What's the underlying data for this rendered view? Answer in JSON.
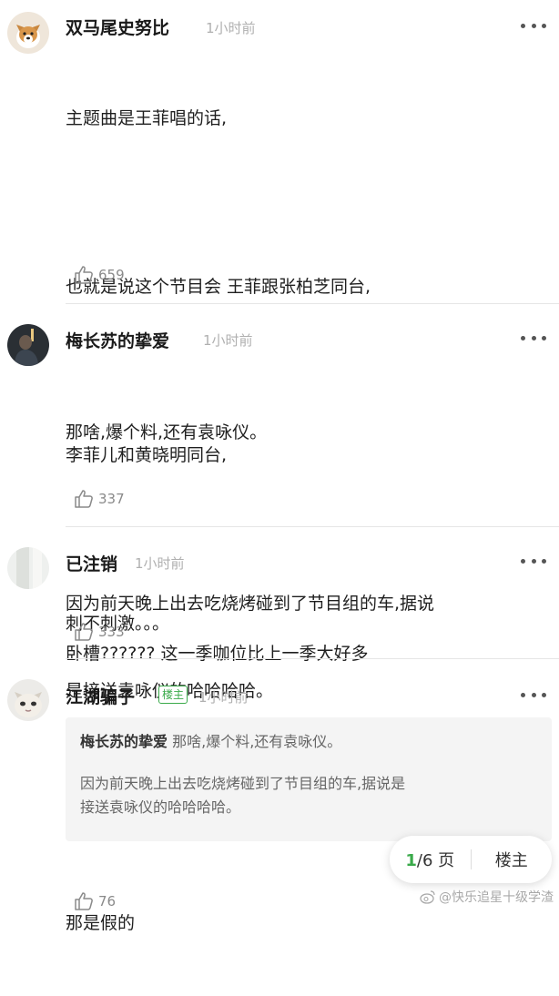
{
  "comments": [
    {
      "username": "双马尾史努比",
      "time": "1小时前",
      "lines": [
        "主题曲是王菲唱的话,",
        "",
        "也就是说这个节目会 王菲跟张柏芝同台,",
        "",
        "李菲儿和黄晓明同台,",
        "",
        "刺不刺激。。。"
      ],
      "likes": "659"
    },
    {
      "username": "梅长苏的挚爱",
      "time": "1小时前",
      "lines": [
        "那啥,爆个料,还有袁咏仪。",
        "",
        "因为前天晚上出去吃烧烤碰到了节目组的车,据说",
        "是接送袁咏仪的哈哈哈哈。"
      ],
      "likes": "337"
    },
    {
      "username": "已注销",
      "time": "1小时前",
      "lines": [
        "卧槽?????? 这一季咖位比上一季大好多"
      ],
      "likes": "333"
    },
    {
      "username": "江湖骗子",
      "badge": "楼主",
      "time": "1小时前",
      "quote": {
        "username": "梅长苏的挚爱",
        "first": "那啥,爆个料,还有袁咏仪。",
        "rest": [
          "因为前天晚上出去吃烧烤碰到了节目组的车,据说是",
          "接送袁咏仪的哈哈哈哈。"
        ]
      },
      "lines": [
        "那是假的"
      ],
      "likes": "76"
    }
  ],
  "pager": {
    "current": "1",
    "total_suffix": "/6 页",
    "op_button": "楼主"
  },
  "watermark": "@快乐追星十级学渣",
  "colors": {
    "accent": "#3aaa4a",
    "time": "#b0b0b0",
    "text": "#1f1f1f"
  }
}
